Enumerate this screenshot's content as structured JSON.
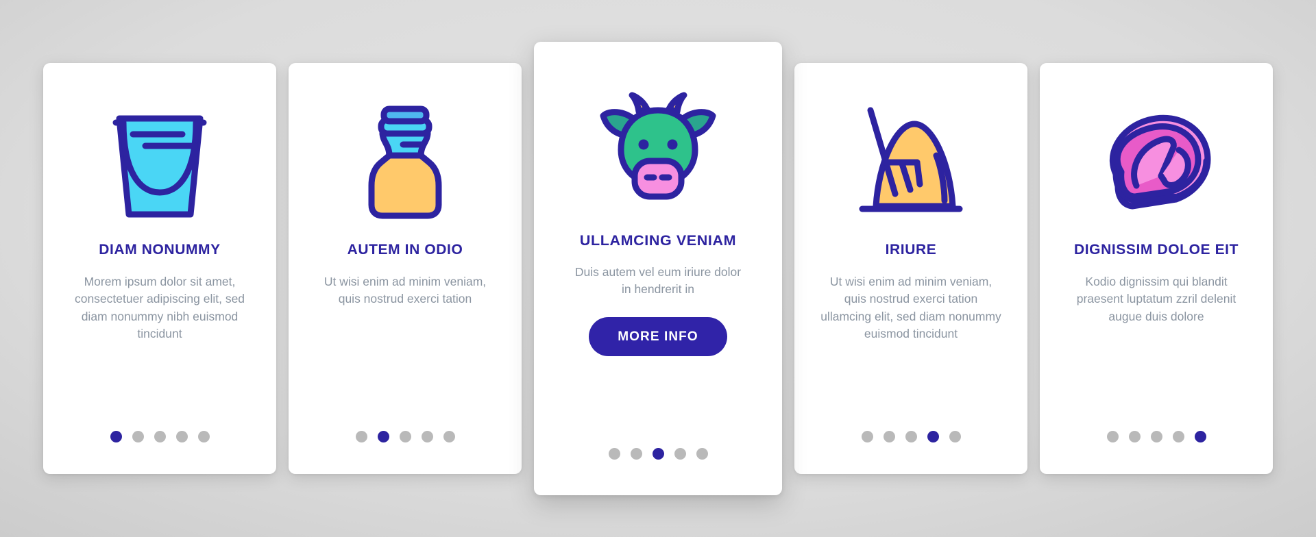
{
  "colors": {
    "accent": "#2d23a0",
    "cta_background": "#3023a8",
    "cta_text": "#ffffff",
    "body_text": "#8b95a1",
    "dot_inactive": "#b9b9b9",
    "dot_active": "#2d23a0",
    "card_background": "#ffffff",
    "page_background": "#d5d5d5",
    "icon_outline": "#2d23a0",
    "icon_cyan": "#4ad6f5",
    "icon_cyan_dark": "#4fb8ef",
    "icon_amber": "#ffc96b",
    "icon_green": "#2ec28b",
    "icon_teal": "#2aa58e",
    "icon_pink": "#f78fe0",
    "icon_magenta": "#e85bc8"
  },
  "cards": [
    {
      "icon": "milk-bucket-icon",
      "title": "DIAM NONUMMY",
      "body": "Morem ipsum dolor sit amet, consectetuer adipiscing elit, sed diam nonummy nibh euismod tincidunt",
      "dots": {
        "count": 5,
        "active_index": 0
      },
      "featured": false,
      "cta_label": null
    },
    {
      "icon": "milk-bottle-icon",
      "title": "AUTEM IN ODIO",
      "body": "Ut wisi enim ad minim veniam, quis nostrud exerci tation",
      "dots": {
        "count": 5,
        "active_index": 1
      },
      "featured": false,
      "cta_label": null
    },
    {
      "icon": "cow-head-icon",
      "title": "ULLAMCING VENIAM",
      "body": "Duis autem vel eum iriure dolor in hendrerit in",
      "dots": {
        "count": 5,
        "active_index": 2
      },
      "featured": true,
      "cta_label": "MORE INFO"
    },
    {
      "icon": "haystack-pitchfork-icon",
      "title": "IRIURE",
      "body": "Ut wisi enim ad minim veniam, quis nostrud exerci tation ullamcing elit, sed diam nonummy euismod tincidunt",
      "dots": {
        "count": 5,
        "active_index": 3
      },
      "featured": false,
      "cta_label": null
    },
    {
      "icon": "steak-meat-icon",
      "title": "DIGNISSIM DOLOE EIT",
      "body": "Kodio dignissim qui blandit praesent luptatum zzril delenit augue duis dolore",
      "dots": {
        "count": 5,
        "active_index": 4
      },
      "featured": false,
      "cta_label": null
    }
  ]
}
